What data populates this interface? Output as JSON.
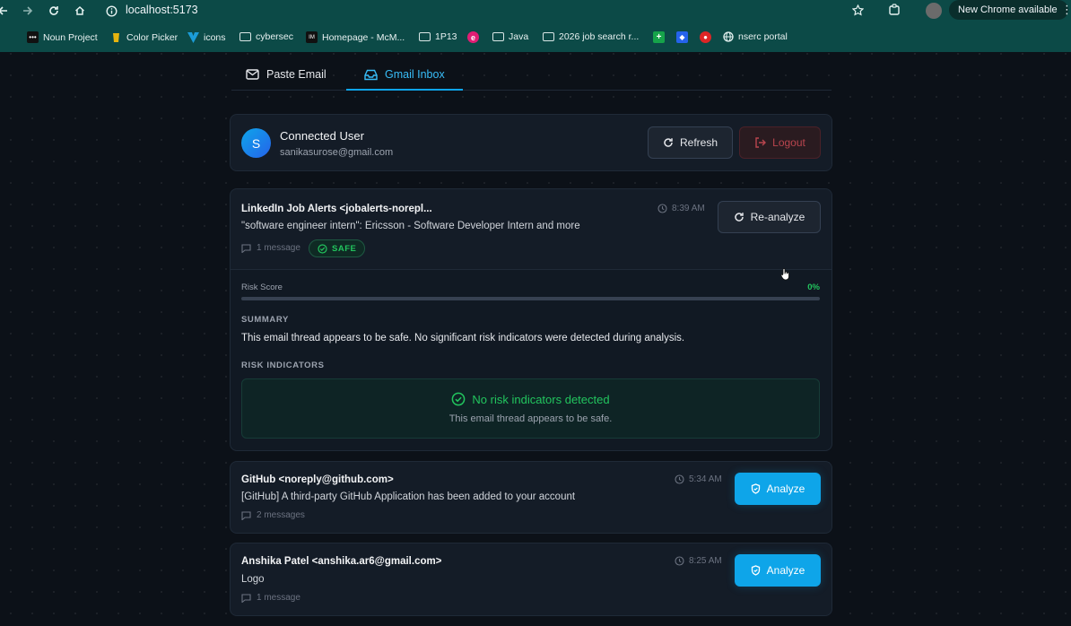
{
  "browser": {
    "url": "localhost:5173",
    "update_label": "New Chrome available",
    "bookmarks": [
      {
        "label": "Noun Project",
        "icon": "noun-project-icon",
        "color": "#111111"
      },
      {
        "label": "Color Picker",
        "icon": "color-picker-icon",
        "color": "#e7b40f"
      },
      {
        "label": "icons",
        "icon": "vuetify-icon",
        "color": "#1b9cd7"
      },
      {
        "label": "cybersec",
        "icon": "folder-icon"
      },
      {
        "label": "Homepage - McM...",
        "icon": "imdb-icon",
        "color": "#111111"
      },
      {
        "label": "1P13",
        "icon": "folder-icon"
      },
      {
        "label": "",
        "icon": "e-icon",
        "color": "#e11d74"
      },
      {
        "label": "Java",
        "icon": "folder-icon"
      },
      {
        "label": "2026 job search r...",
        "icon": "folder-icon"
      },
      {
        "label": "",
        "icon": "sheets-icon",
        "color": "#16a34a"
      },
      {
        "label": "",
        "icon": "app-icon",
        "color": "#2563eb"
      },
      {
        "label": "",
        "icon": "app-icon-2",
        "color": "#dc2626"
      },
      {
        "label": "nserc portal",
        "icon": "globe-icon"
      }
    ]
  },
  "tabs": {
    "paste": "Paste Email",
    "gmail": "Gmail Inbox",
    "active": "gmail"
  },
  "user": {
    "initial": "S",
    "status": "Connected User",
    "email": "sanikasurose@gmail.com",
    "refresh_label": "Refresh",
    "logout_label": "Logout"
  },
  "emails": [
    {
      "sender": "LinkedIn Job Alerts <jobalerts-norepl...",
      "subject": "\"software engineer intern\": Ericsson - Software Developer Intern and more",
      "time": "8:39 AM",
      "messages": "1 message",
      "badge": "SAFE",
      "action_label": "Re-analyze",
      "analysis": {
        "risk_label": "Risk Score",
        "risk_score_text": "0%",
        "risk_score": 0,
        "summary_heading": "SUMMARY",
        "summary": "This email thread appears to be safe. No significant risk indicators were detected during analysis.",
        "indicators_heading": "RISK INDICATORS",
        "no_risk_title": "No risk indicators detected",
        "no_risk_sub": "This email thread appears to be safe."
      }
    },
    {
      "sender": "GitHub <noreply@github.com>",
      "subject": "[GitHub] A third-party GitHub Application has been added to your account",
      "time": "5:34 AM",
      "messages": "2 messages",
      "action_label": "Analyze"
    },
    {
      "sender": "Anshika Patel <anshika.ar6@gmail.com>",
      "subject": "Logo",
      "time": "8:25 AM",
      "messages": "1 message",
      "action_label": "Analyze"
    }
  ],
  "colors": {
    "accent": "#0ea5e9",
    "safe": "#22c55e",
    "danger": "#b9454e",
    "chrome_frame": "#0c4a47"
  }
}
